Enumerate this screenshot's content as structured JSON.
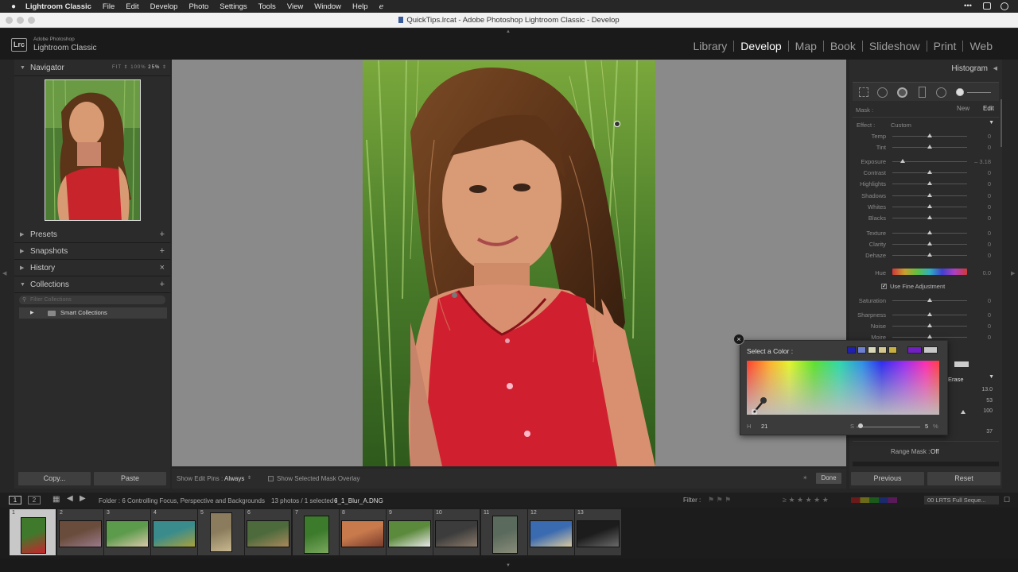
{
  "menubar": {
    "app_name": "Lightroom Classic",
    "items": [
      "File",
      "Edit",
      "Develop",
      "Photo",
      "Settings",
      "Tools",
      "View",
      "Window",
      "Help"
    ]
  },
  "window_title": "QuickTips.lrcat - Adobe Photoshop Lightroom Classic - Develop",
  "identity": {
    "badge": "Lrc",
    "line1": "Adobe Photoshop",
    "line2": "Lightroom Classic"
  },
  "modules": {
    "items": [
      "Library",
      "Develop",
      "Map",
      "Book",
      "Slideshow",
      "Print",
      "Web"
    ],
    "active": "Develop"
  },
  "navigator": {
    "title": "Navigator",
    "zoom_options": [
      "FIT",
      "100%",
      "25%"
    ]
  },
  "left_panels": {
    "presets": "Presets",
    "snapshots": "Snapshots",
    "history": "History",
    "collections": "Collections",
    "filter_placeholder": "Filter Collections",
    "smart_collections": "Smart Collections"
  },
  "left_buttons": {
    "copy": "Copy...",
    "paste": "Paste"
  },
  "right_panel": {
    "histogram": "Histogram",
    "mask_label": "Mask :",
    "new": "New",
    "edit": "Edit",
    "effect_label": "Effect :",
    "effect_value": "Custom",
    "use_fine_adjustment": "Use Fine Adjustment",
    "erase": "Erase",
    "range_mask": "Range Mask :",
    "range_mask_value": "Off",
    "extra_values": [
      "13.0",
      "53",
      "100",
      "37"
    ]
  },
  "sliders": [
    {
      "label": "Temp",
      "value": "0",
      "pos": 0.5
    },
    {
      "label": "Tint",
      "value": "0",
      "pos": 0.5
    },
    {
      "label": "Exposure",
      "value": "– 3.18",
      "pos": 0.14
    },
    {
      "label": "Contrast",
      "value": "0",
      "pos": 0.5
    },
    {
      "label": "Highlights",
      "value": "0",
      "pos": 0.5
    },
    {
      "label": "Shadows",
      "value": "0",
      "pos": 0.5
    },
    {
      "label": "Whites",
      "value": "0",
      "pos": 0.5
    },
    {
      "label": "Blacks",
      "value": "0",
      "pos": 0.5
    },
    {
      "label": "Texture",
      "value": "0",
      "pos": 0.5
    },
    {
      "label": "Clarity",
      "value": "0",
      "pos": 0.5
    },
    {
      "label": "Dehaze",
      "value": "0",
      "pos": 0.5
    },
    {
      "label": "Hue",
      "value": "0.0",
      "pos": 0.5
    },
    {
      "label": "Saturation",
      "value": "0",
      "pos": 0.5
    },
    {
      "label": "Sharpness",
      "value": "0",
      "pos": 0.5
    },
    {
      "label": "Noise",
      "value": "0",
      "pos": 0.5
    },
    {
      "label": "Moire",
      "value": "0",
      "pos": 0.5
    }
  ],
  "right_buttons": {
    "previous": "Previous",
    "reset": "Reset"
  },
  "toolbar": {
    "show_edit_pins": "Show Edit Pins :",
    "edit_pins_value": "Always",
    "show_mask_overlay": "Show Selected Mask Overlay",
    "done": "Done"
  },
  "color_picker": {
    "title": "Select a Color :",
    "h_label": "H",
    "h_value": "21",
    "s_label": "S",
    "s_value": "5",
    "s_unit": "%",
    "swatches": [
      "#1f1fb0",
      "#6f7fd0",
      "#d8d8b8",
      "#d2c890",
      "#c8b040",
      "#7020c0",
      "#c8c8c8"
    ]
  },
  "filmstrip_header": {
    "pages": [
      "1",
      "2"
    ],
    "folder": "Folder : 6 Controlling Focus, Perspective and Backgrounds",
    "count": "13 photos / 1 selected /",
    "filename": "6_1_Blur_A.DNG",
    "filter": "Filter :",
    "preset": "00 LRTS Full Seque..."
  },
  "filmstrip": [
    {
      "n": "1",
      "c1": "#3f7a2c",
      "c2": "#c8242c"
    },
    {
      "n": "2",
      "c1": "#6a4c3c",
      "c2": "#9a7a8a"
    },
    {
      "n": "3",
      "c1": "#5c9a4c",
      "c2": "#d8c8a8"
    },
    {
      "n": "4",
      "c1": "#3a8c8c",
      "c2": "#a8a03c"
    },
    {
      "n": "5",
      "c1": "#8a7c5c",
      "c2": "#c8b890"
    },
    {
      "n": "6",
      "c1": "#4c6a3c",
      "c2": "#a8885c"
    },
    {
      "n": "7",
      "c1": "#3c7a2c",
      "c2": "#7aa85c"
    },
    {
      "n": "8",
      "c1": "#c87a4c",
      "c2": "#7a3c2c"
    },
    {
      "n": "9",
      "c1": "#5c8a3c",
      "c2": "#e8e8e8"
    },
    {
      "n": "10",
      "c1": "#3c3c3c",
      "c2": "#8a7a6a"
    },
    {
      "n": "11",
      "c1": "#5a6a5c",
      "c2": "#8a8c7a"
    },
    {
      "n": "12",
      "c1": "#3a6ab0",
      "c2": "#d8c8a0"
    },
    {
      "n": "13",
      "c1": "#1c1c1c",
      "c2": "#6a6a6a"
    }
  ]
}
